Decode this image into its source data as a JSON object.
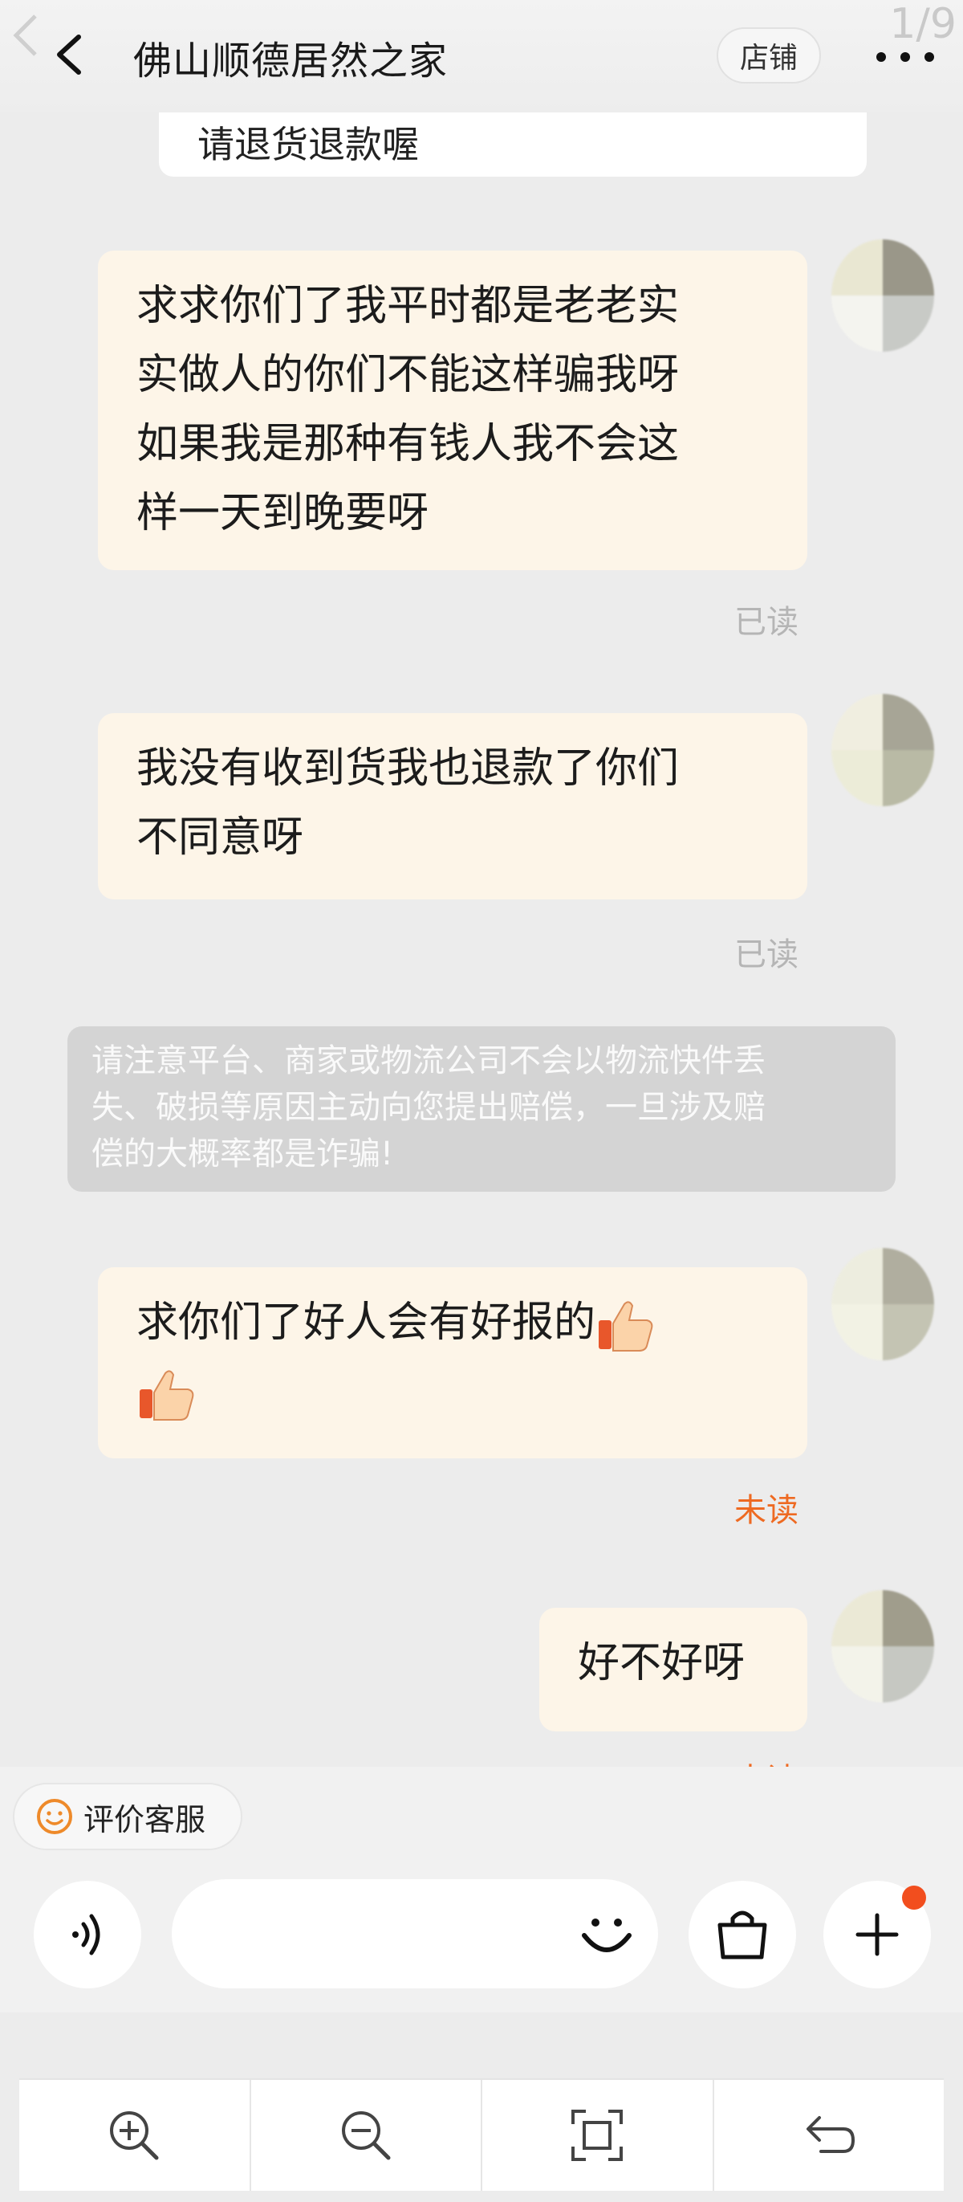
{
  "viewer": {
    "page_counter": "1/9"
  },
  "header": {
    "title": "佛山顺德居然之家",
    "shop_button": "店铺"
  },
  "partial_message": "请退货退款喔",
  "messages": [
    {
      "lines": [
        "求求你们了我平时都是老老实",
        "实做人的你们不能这样骗我呀",
        "如果我是那种有钱人我不会这",
        "样一天到晚要呀"
      ],
      "status": "已读"
    },
    {
      "lines": [
        "我没有收到货我也退款了你们",
        "不同意呀"
      ],
      "status": "已读"
    },
    {
      "lines": [
        "求你们了好人会有好报的",
        ""
      ],
      "status": "未读",
      "emoji": "thumbs-up"
    },
    {
      "lines": [
        "好不好呀"
      ],
      "status": "未读"
    }
  ],
  "notice": {
    "lines": [
      "请注意平台、商家或物流公司不会以物流快件丢",
      "失、破损等原因主动向您提出赔偿，一旦涉及赔",
      "偿的大概率都是诈骗!"
    ]
  },
  "input_bar": {
    "rate_label": "评价客服"
  },
  "icons": {
    "voice": "voice-icon",
    "emoji": "emoji-icon",
    "bag": "shopping-bag-icon",
    "add": "plus-icon",
    "zoom_in": "zoom-in-icon",
    "zoom_out": "zoom-out-icon",
    "fit": "fit-screen-icon",
    "undo": "undo-icon"
  },
  "colors": {
    "bubble": "#fdf5e8",
    "read": "#b5b5b5",
    "unread": "#ee6a22",
    "notice_bg": "#d4d4d4",
    "badge": "#f24e1e"
  }
}
